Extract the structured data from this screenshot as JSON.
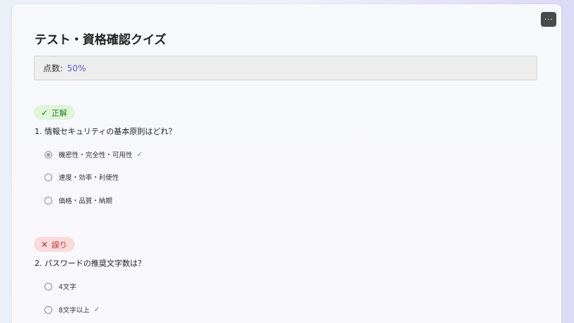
{
  "quiz": {
    "title": "テスト・資格確認クイズ",
    "more_label": "···",
    "score_label": "点数:",
    "score_value": "50%"
  },
  "questions": [
    {
      "badge_label": "正解",
      "badge_icon": "check-icon",
      "badge_color": "#1f7a28",
      "text": "1. 情報セキュリティの基本原則はどれ？",
      "options": [
        {
          "label": "機密性・完全性・可用性",
          "selected": true,
          "correct": true
        },
        {
          "label": "速度・効率・利便性",
          "selected": false,
          "correct": false
        },
        {
          "label": "価格・品質・納期",
          "selected": false,
          "correct": false
        }
      ]
    },
    {
      "badge_label": "誤り",
      "badge_icon": "x-icon",
      "badge_color": "#c42b2b",
      "text": "2. パスワードの推奨文字数は？",
      "options": [
        {
          "label": "4文字",
          "selected": false,
          "correct": false
        },
        {
          "label": "8文字以上",
          "selected": false,
          "correct": true
        }
      ]
    }
  ],
  "colors": {
    "accent": "#5b5fc7",
    "correct": "#3c9a50",
    "wrong": "#c42b2b"
  }
}
